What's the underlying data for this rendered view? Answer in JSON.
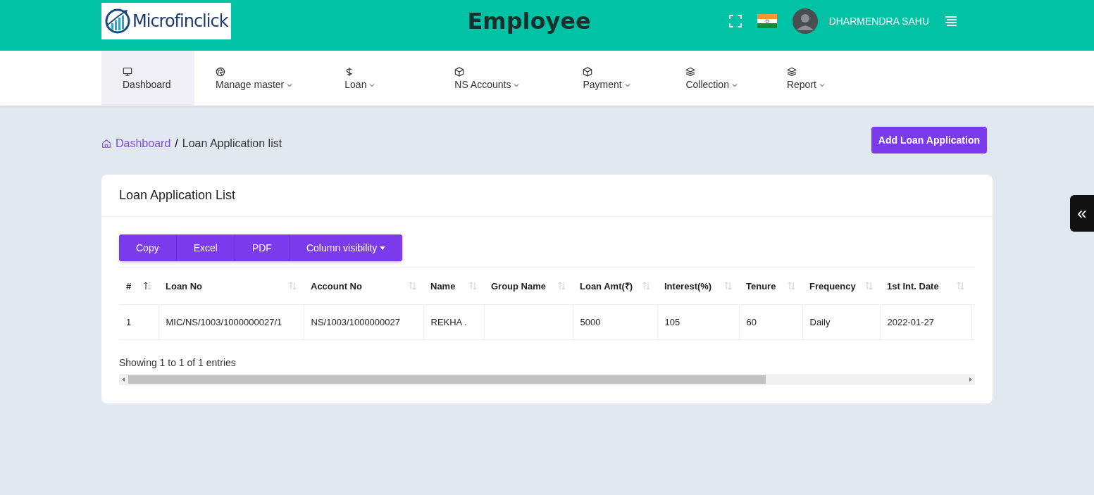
{
  "header": {
    "logo_text": "Microfinclick",
    "title": "Employee",
    "user_name": "DHARMENDRA SAHU"
  },
  "nav": [
    {
      "label": "Dashboard",
      "kind": "monitor",
      "dropdown": false,
      "selected": true
    },
    {
      "label": "Manage master",
      "kind": "aperture",
      "dropdown": true,
      "selected": false
    },
    {
      "label": "Loan",
      "kind": "dollar",
      "dropdown": true,
      "selected": false
    },
    {
      "label": "NS Accounts",
      "kind": "box",
      "dropdown": true,
      "selected": false
    },
    {
      "label": "Payment",
      "kind": "box",
      "dropdown": true,
      "selected": false
    },
    {
      "label": "Collection",
      "kind": "layers",
      "dropdown": true,
      "selected": false
    },
    {
      "label": "Report",
      "kind": "layers",
      "dropdown": true,
      "selected": false
    }
  ],
  "breadcrumb": {
    "home": "Dashboard",
    "separator": "/",
    "current": "Loan Application list"
  },
  "add_button": "Add Loan Application",
  "collapse_button": "«",
  "card": {
    "title": "Loan Application List",
    "export_buttons": [
      {
        "label": "Copy",
        "dropdown": false
      },
      {
        "label": "Excel",
        "dropdown": false
      },
      {
        "label": "PDF",
        "dropdown": false
      },
      {
        "label": "Column visibility",
        "dropdown": true
      }
    ],
    "table": {
      "columns": [
        {
          "label": "#",
          "sorted": true
        },
        {
          "label": "Loan No",
          "sorted": false
        },
        {
          "label": "Account No",
          "sorted": false
        },
        {
          "label": "Name",
          "sorted": false
        },
        {
          "label": "Group Name",
          "sorted": false
        },
        {
          "label": "Loan Amt(₹)",
          "sorted": false
        },
        {
          "label": "Interest(%)",
          "sorted": false
        },
        {
          "label": "Tenure",
          "sorted": false
        },
        {
          "label": "Frequency",
          "sorted": false
        },
        {
          "label": "1st Int. Date",
          "sorted": false
        }
      ],
      "rows": [
        [
          "1",
          "MIC/NS/1003/1000000027/1",
          "NS/1003/1000000027",
          "REKHA .",
          "",
          "5000",
          "105",
          "60",
          "Daily",
          "2022-01-27"
        ]
      ]
    },
    "info": "Showing 1 to 1 of 1 entries"
  }
}
